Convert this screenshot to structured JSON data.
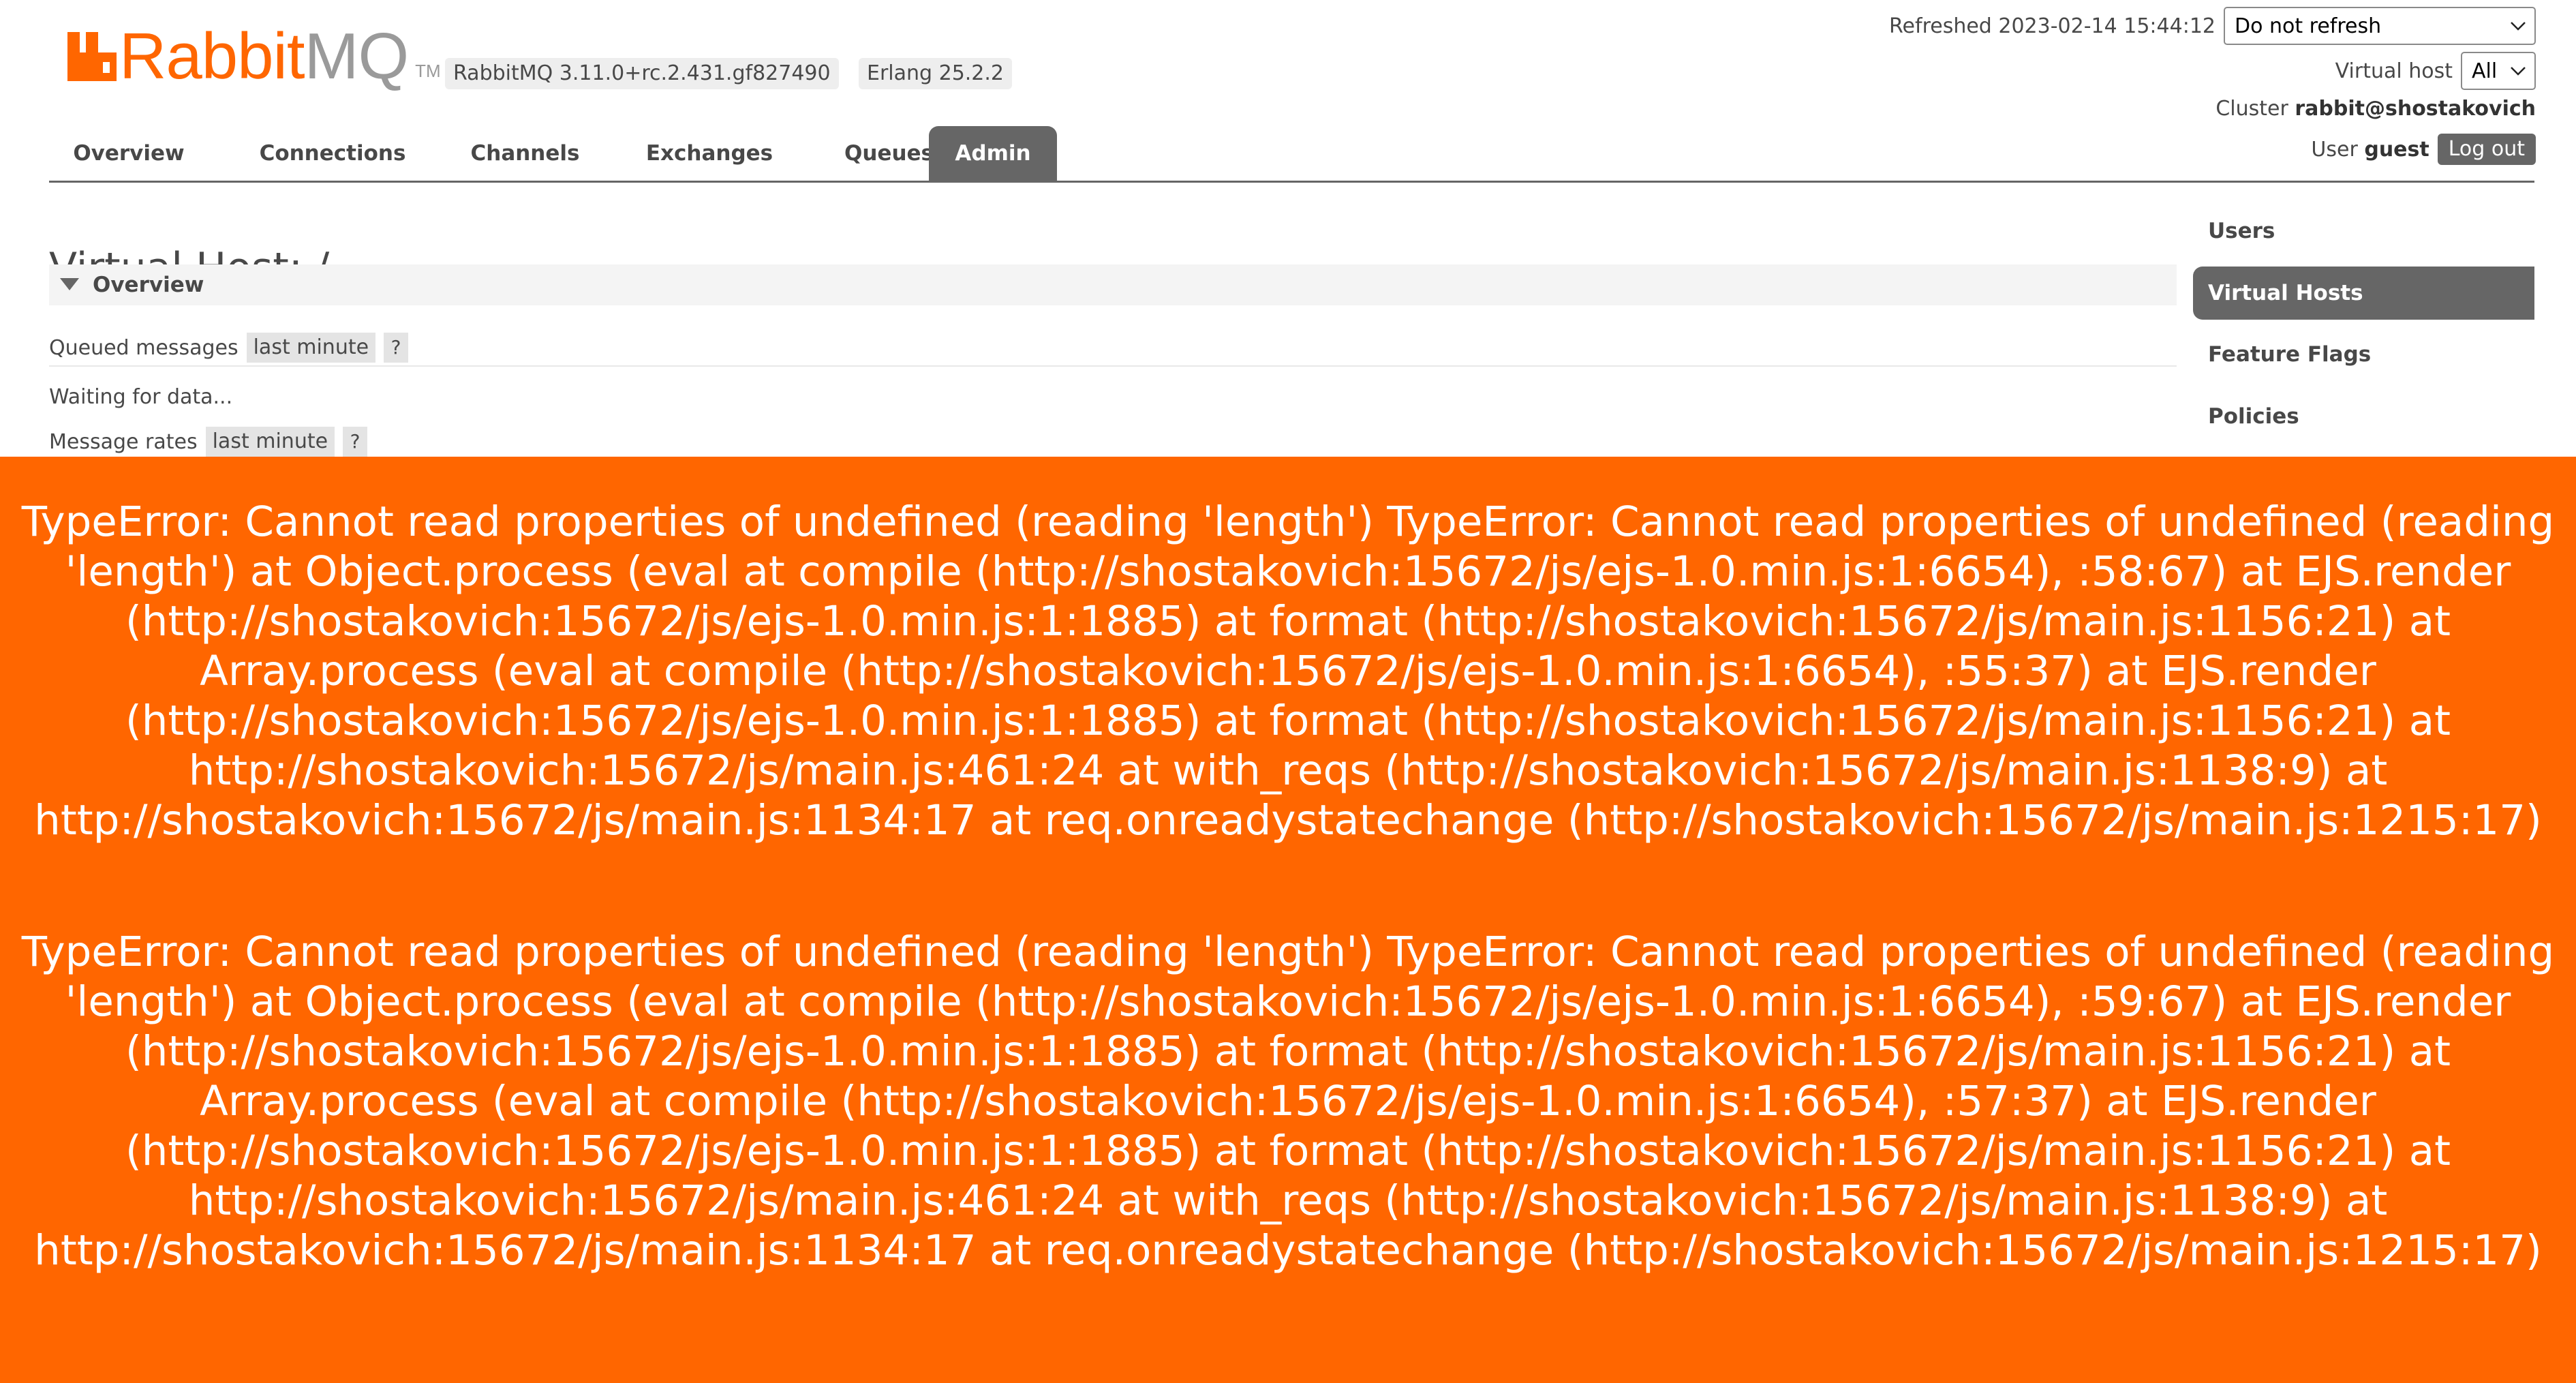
{
  "header": {
    "logo_word_rabbit": "Rabbit",
    "logo_word_mq": "MQ",
    "logo_tm": "TM",
    "rabbitmq_version": "RabbitMQ 3.11.0+rc.2.431.gf827490",
    "erlang_version": "Erlang 25.2.2",
    "refreshed_label": "Refreshed 2023-02-14 15:44:12",
    "refresh_select_value": "Do not refresh",
    "virtual_host_label": "Virtual host",
    "virtual_host_value": "All",
    "cluster_label": "Cluster",
    "cluster_name": "rabbit@shostakovich",
    "user_label": "User",
    "user_name": "guest",
    "logout_label": "Log out"
  },
  "tabs": [
    {
      "label": "Overview",
      "active": false
    },
    {
      "label": "Connections",
      "active": false
    },
    {
      "label": "Channels",
      "active": false
    },
    {
      "label": "Exchanges",
      "active": false
    },
    {
      "label": "Queues",
      "active": false
    },
    {
      "label": "Admin",
      "active": true
    }
  ],
  "main": {
    "title": "Virtual Host: /",
    "section_title": "Overview",
    "queued_messages_label": "Queued messages",
    "queued_messages_range": "last minute",
    "help_label": "?",
    "waiting_text": "Waiting for data...",
    "message_rates_label": "Message rates",
    "message_rates_range": "last minute"
  },
  "sidebar": {
    "items": [
      {
        "label": "Users",
        "active": false
      },
      {
        "label": "Virtual Hosts",
        "active": true
      },
      {
        "label": "Feature Flags",
        "active": false
      },
      {
        "label": "Policies",
        "active": false
      }
    ]
  },
  "errors": [
    "TypeError: Cannot read properties of undefined (reading 'length') TypeError: Cannot read properties of undefined (reading 'length') at Object.process (eval at compile (http://shostakovich:15672/js/ejs-1.0.min.js:1:6654), :58:67) at EJS.render (http://shostakovich:15672/js/ejs-1.0.min.js:1:1885) at format (http://shostakovich:15672/js/main.js:1156:21) at Array.process (eval at compile (http://shostakovich:15672/js/ejs-1.0.min.js:1:6654), :55:37) at EJS.render (http://shostakovich:15672/js/ejs-1.0.min.js:1:1885) at format (http://shostakovich:15672/js/main.js:1156:21) at http://shostakovich:15672/js/main.js:461:24 at with_reqs (http://shostakovich:15672/js/main.js:1138:9) at http://shostakovich:15672/js/main.js:1134:17 at req.onreadystatechange (http://shostakovich:15672/js/main.js:1215:17)",
    "TypeError: Cannot read properties of undefined (reading 'length') TypeError: Cannot read properties of undefined (reading 'length') at Object.process (eval at compile (http://shostakovich:15672/js/ejs-1.0.min.js:1:6654), :59:67) at EJS.render (http://shostakovich:15672/js/ejs-1.0.min.js:1:1885) at format (http://shostakovich:15672/js/main.js:1156:21) at Array.process (eval at compile (http://shostakovich:15672/js/ejs-1.0.min.js:1:6654), :57:37) at EJS.render (http://shostakovich:15672/js/ejs-1.0.min.js:1:1885) at format (http://shostakovich:15672/js/main.js:1156:21) at http://shostakovich:15672/js/main.js:461:24 at with_reqs (http://shostakovich:15672/js/main.js:1138:9) at http://shostakovich:15672/js/main.js:1134:17 at req.onreadystatechange (http://shostakovich:15672/js/main.js:1215:17)"
  ],
  "colors": {
    "brand_orange": "#ff6600",
    "logo_grey": "#9a9a9a",
    "active_tab": "#666666",
    "text": "#484848"
  },
  "icons": {
    "logo": "rabbitmq-logo-icon",
    "dropdown": "chevron-down-icon",
    "section_toggle": "triangle-down-icon"
  }
}
